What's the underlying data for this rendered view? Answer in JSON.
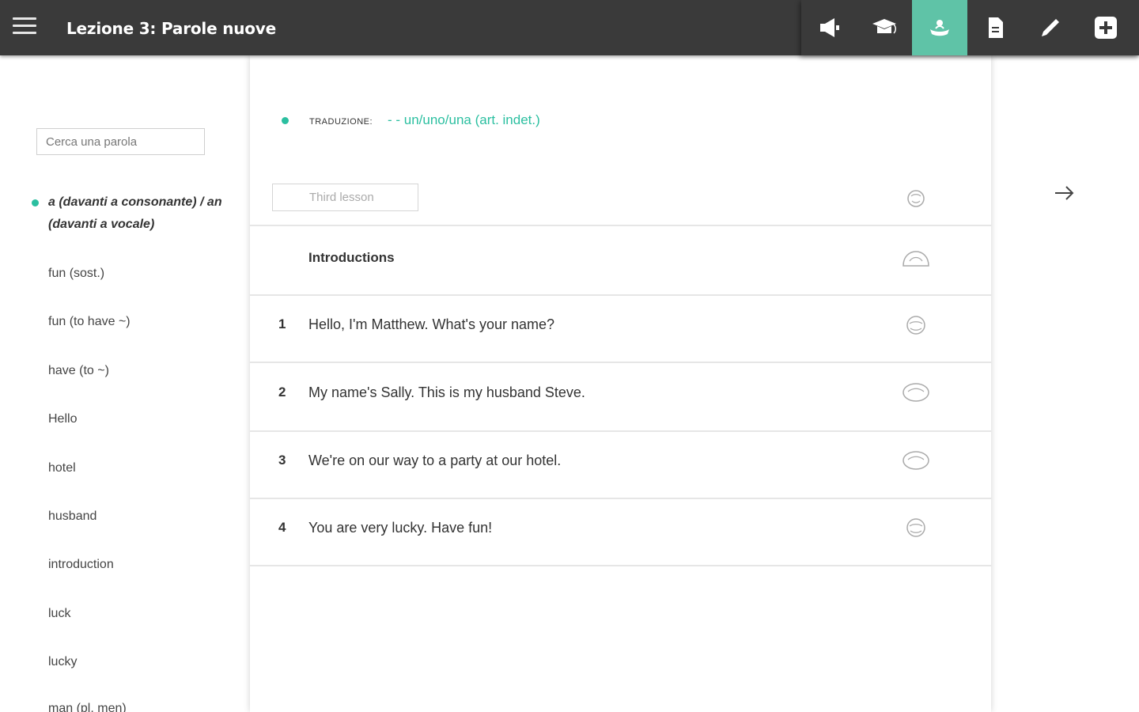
{
  "header": {
    "title": "Lezione 3: Parole nuove",
    "menu_icon": "hamburger-icon",
    "toolbar": [
      {
        "icon": "megaphone-icon",
        "active": false
      },
      {
        "icon": "graduation-cap-icon",
        "active": false
      },
      {
        "icon": "hand-icon",
        "active": true
      },
      {
        "icon": "document-icon",
        "active": false
      },
      {
        "icon": "pencil-icon",
        "active": false
      },
      {
        "icon": "plus-box-icon",
        "active": false
      }
    ],
    "accent_color": "#5fc3a7"
  },
  "sidebar": {
    "search_placeholder": "Cerca una parola",
    "words": [
      {
        "label": "a (davanti a consonante) / an (davanti a vocale)",
        "active": true
      },
      {
        "label": "fun (sost.)"
      },
      {
        "label": "fun (to have ~)"
      },
      {
        "label": "have (to ~)"
      },
      {
        "label": "Hello"
      },
      {
        "label": "hotel"
      },
      {
        "label": "husband"
      },
      {
        "label": "introduction"
      },
      {
        "label": "luck"
      },
      {
        "label": "lucky"
      },
      {
        "label": "man (pl. men)"
      }
    ]
  },
  "main": {
    "translation_label": "Traduzione:",
    "translation_value": "- - un/uno/una (art. indet.)",
    "lesson_placeholder": "Third lesson",
    "rows": [
      {
        "num": "",
        "text": "Introductions",
        "heading": true
      },
      {
        "num": "1",
        "text": "Hello, I'm Matthew. What's your name?"
      },
      {
        "num": "2",
        "text": "My name's Sally. This is my husband Steve."
      },
      {
        "num": "3",
        "text": "We're on our way to a party at our hotel."
      },
      {
        "num": "4",
        "text": "You are very lucky. Have fun!"
      }
    ],
    "next_icon": "arrow-right-icon"
  }
}
